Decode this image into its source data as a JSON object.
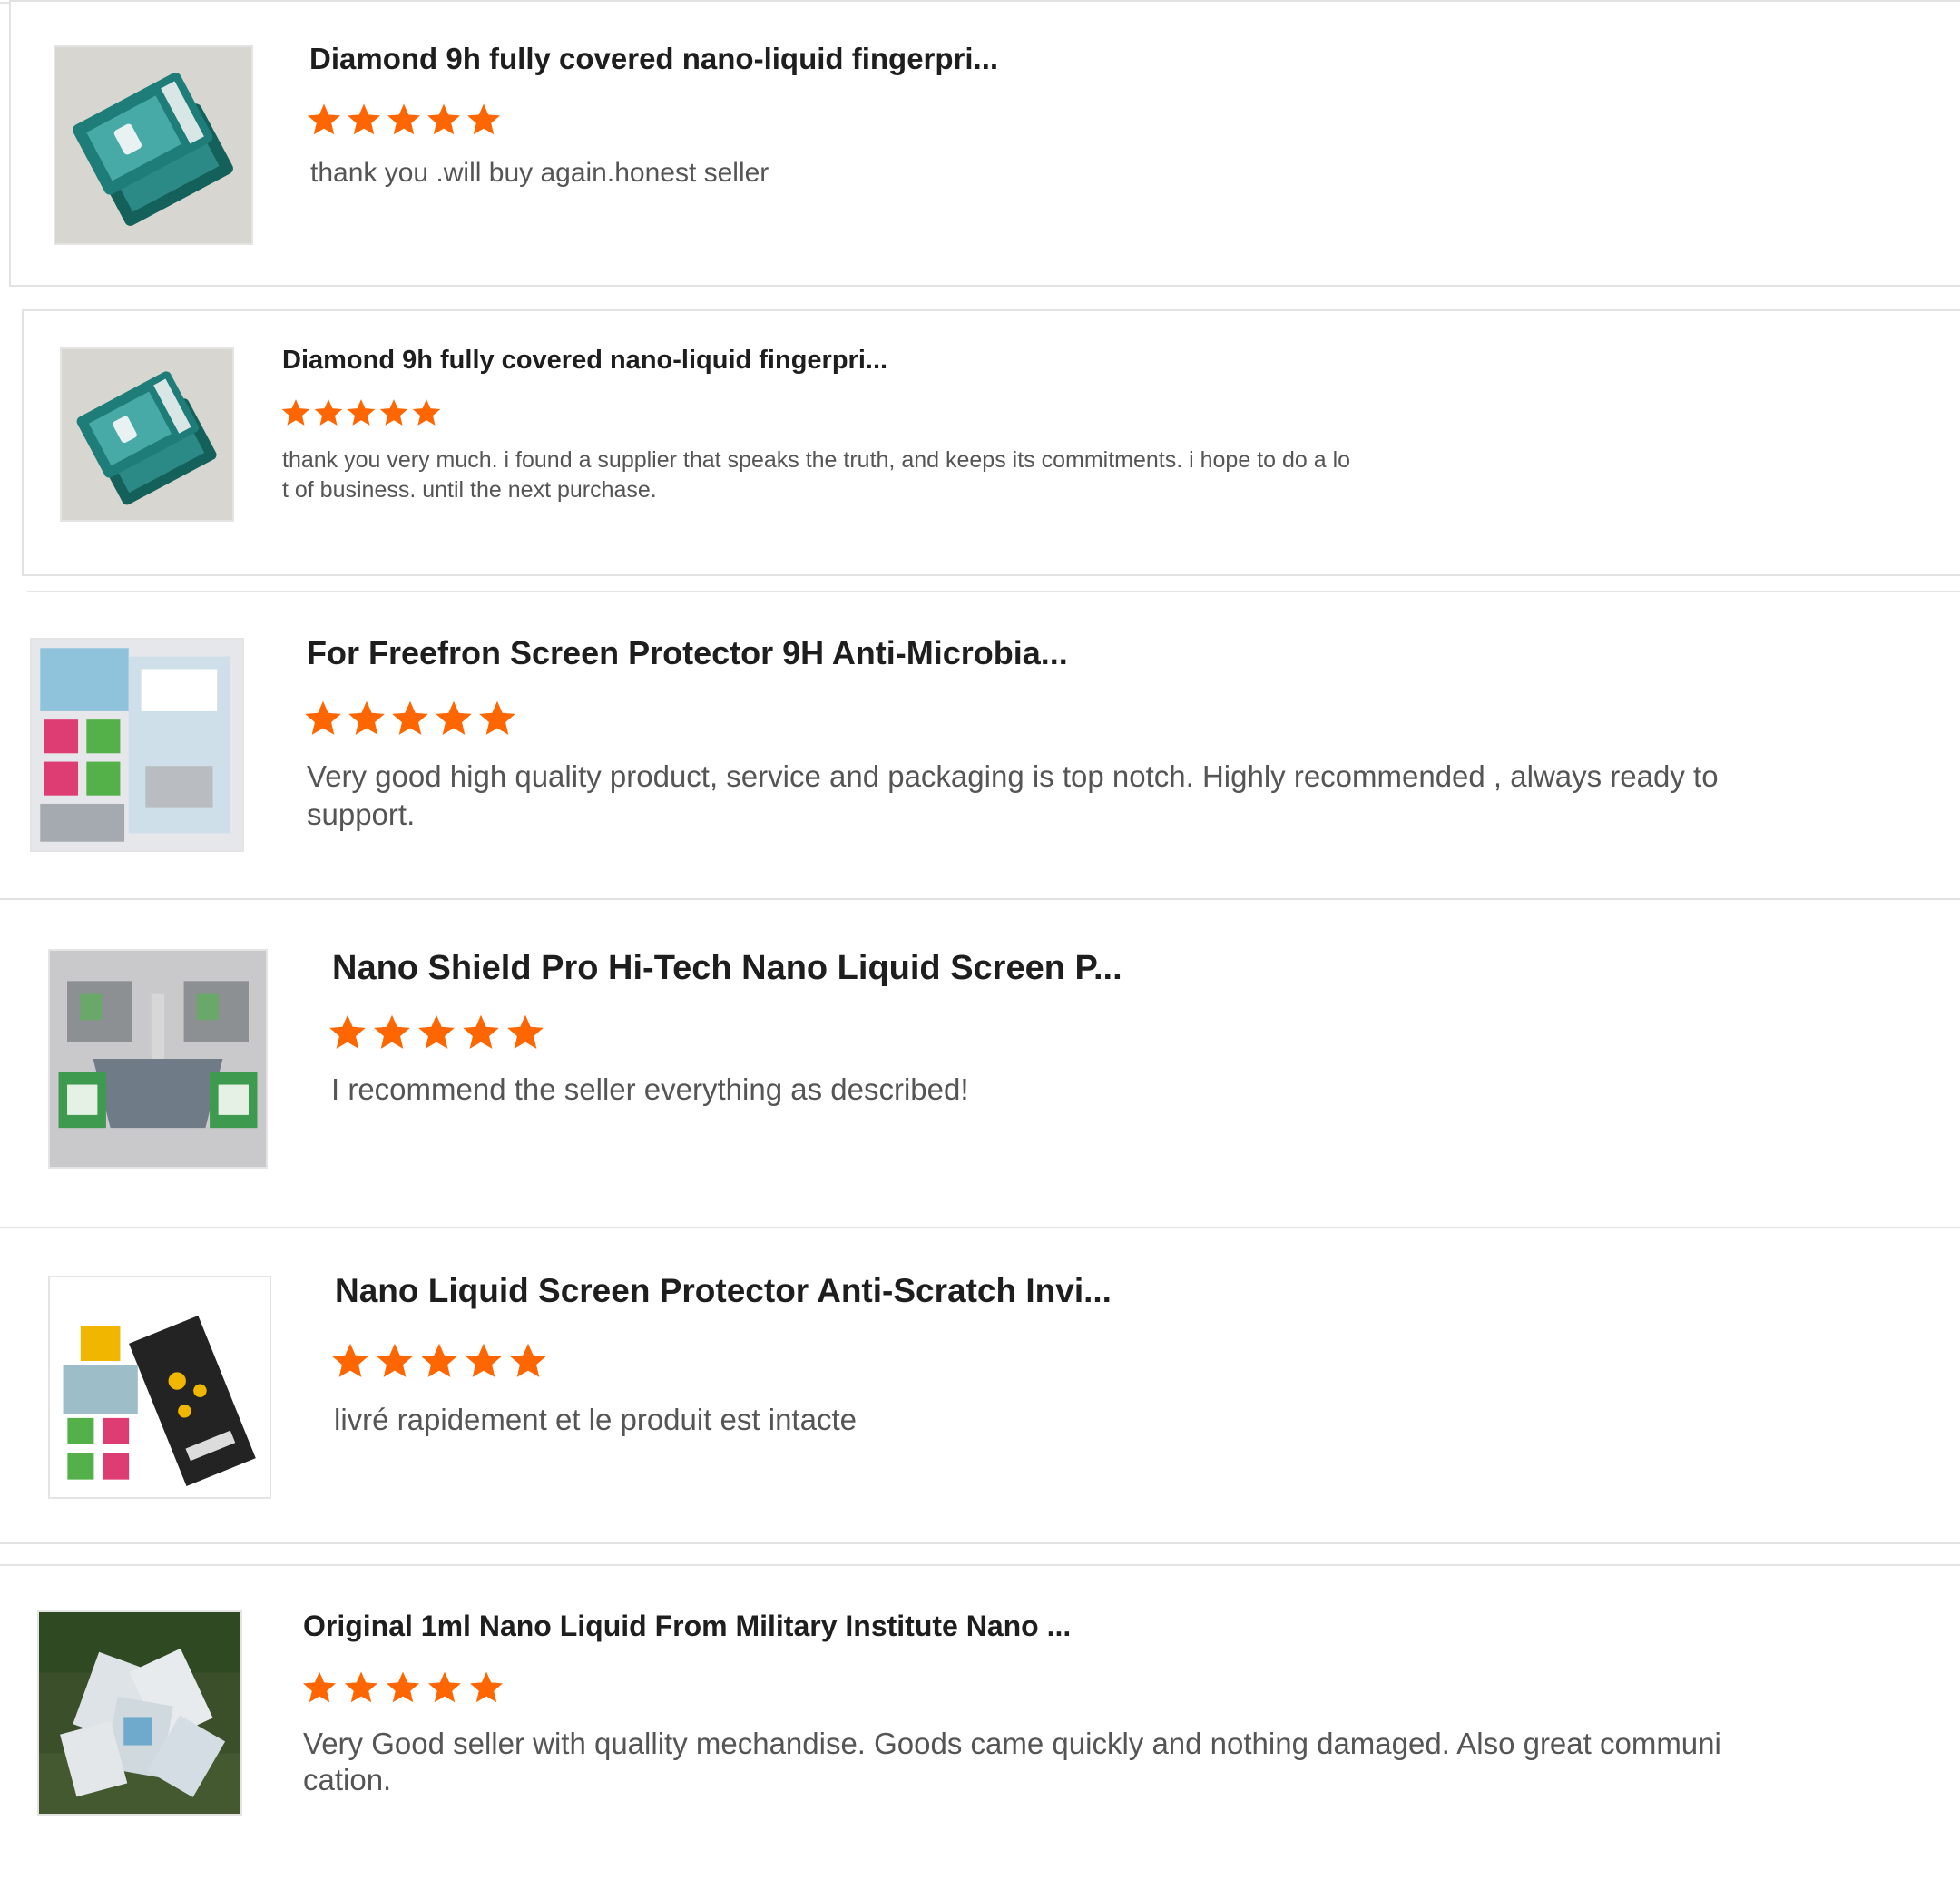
{
  "colors": {
    "star": "#ff6600",
    "title": "#1e1e1e",
    "text": "#555555",
    "border": "#e2e2e2"
  },
  "reviews": [
    {
      "title": "Diamond 9h fully covered nano-liquid fingerpri...",
      "rating": 5,
      "text": "thank you .will buy again.honest seller",
      "image": "boxed-screen-protector-photo"
    },
    {
      "title": "Diamond 9h fully covered nano-liquid fingerpri...",
      "rating": 5,
      "text": "thank you very much. i found a supplier that speaks the truth, and keeps its commitments. i hope to do a lo\nt of business. until the next purchase.",
      "image": "boxed-screen-protector-photo"
    },
    {
      "title": "For Freefron Screen Protector 9H Anti-Microbia...",
      "rating": 5,
      "text": "Very good high quality product, service and packaging is top notch. Highly recommended , always ready to\nsupport.",
      "image": "nano-kit-with-wipes-photo"
    },
    {
      "title": "Nano Shield Pro Hi-Tech Nano Liquid Screen P...",
      "rating": 5,
      "text": "I recommend the seller everything as described!",
      "image": "kit-with-cloth-photo"
    },
    {
      "title": "Nano Liquid Screen Protector Anti-Scratch Invi...",
      "rating": 5,
      "text": "livré rapidement et le produit est intacte",
      "image": "nano-pouch-kit-photo"
    },
    {
      "title": "Original 1ml Nano Liquid From Military Institute Nano ...",
      "rating": 5,
      "text": "Very Good seller with quallity mechandise. Goods came quickly and nothing damaged. Also great communi\ncation.",
      "image": "packs-on-grass-photo"
    }
  ]
}
